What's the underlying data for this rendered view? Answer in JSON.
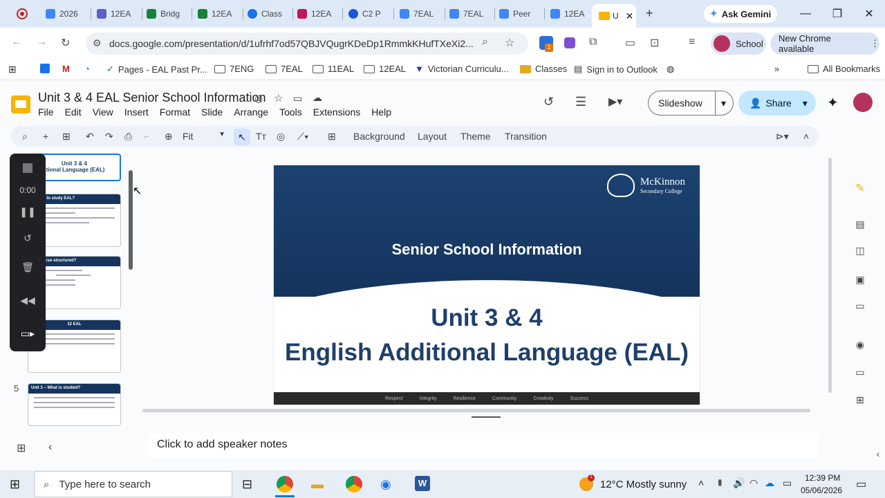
{
  "browser": {
    "tabs": [
      "2026",
      "12EA",
      "Bridg",
      "12EA",
      "Class",
      "12EA",
      "C2 P",
      "7EAL",
      "7EAL",
      "Peer",
      "12EA"
    ],
    "active_tab": "U",
    "ask_gemini": "Ask Gemini",
    "url": "docs.google.com/presentation/d/1ufrhf7od57QBJVQugrKDeDp1RmmkKHufTXeXi2...",
    "profile_label": "School",
    "update_label": "New Chrome available",
    "extension_badge": "1"
  },
  "bookmarks": {
    "items": [
      "Pages - EAL Past Pr...",
      "7ENG",
      "7EAL",
      "11EAL",
      "12EAL",
      "Victorian Curriculu...",
      "Classes",
      "Sign in to Outlook"
    ],
    "all_bookmarks": "All Bookmarks",
    "more": "»"
  },
  "doc": {
    "title": "Unit 3 & 4 EAL  Senior School Information",
    "menu": [
      "File",
      "Edit",
      "View",
      "Insert",
      "Format",
      "Slide",
      "Arrange",
      "Tools",
      "Extensions",
      "Help"
    ],
    "slideshow_label": "Slideshow",
    "share_label": "Share"
  },
  "toolbar": {
    "zoom": "Fit",
    "buttons": [
      "Background",
      "Layout",
      "Theme",
      "Transition"
    ]
  },
  "filmstrip": {
    "thumbs": [
      {
        "title": "Unit 3 & 4",
        "sub": "h Additional Language (EAL)"
      },
      {
        "title": "eligible to study EAL?"
      },
      {
        "title": "the course structured?"
      },
      {
        "title": "12 EAL"
      },
      {
        "num": "5",
        "title": "Unit 3 – What is studied?"
      }
    ]
  },
  "recorder": {
    "time": "0:00"
  },
  "slide": {
    "header": "Senior School Information",
    "title_line1": "Unit 3 & 4",
    "title_line2": "English Additional Language (EAL)",
    "logo_name": "McKinnon",
    "logo_sub": "Secondary College",
    "values": [
      "Respect",
      "Integrity",
      "Resilience",
      "Community",
      "Creativity",
      "Success"
    ]
  },
  "notes": {
    "placeholder": "Click to add speaker notes"
  },
  "taskbar": {
    "search_placeholder": "Type here to search",
    "weather": "12°C  Mostly sunny",
    "time": "12:39 PM",
    "date": "05/06/2026",
    "weather_badge": "1"
  },
  "colors": {
    "slide_navy": "#1d4270",
    "title_navy": "#1f3f6a",
    "share_bg": "#c2e7ff",
    "tabstrip": "#dee9f8"
  }
}
